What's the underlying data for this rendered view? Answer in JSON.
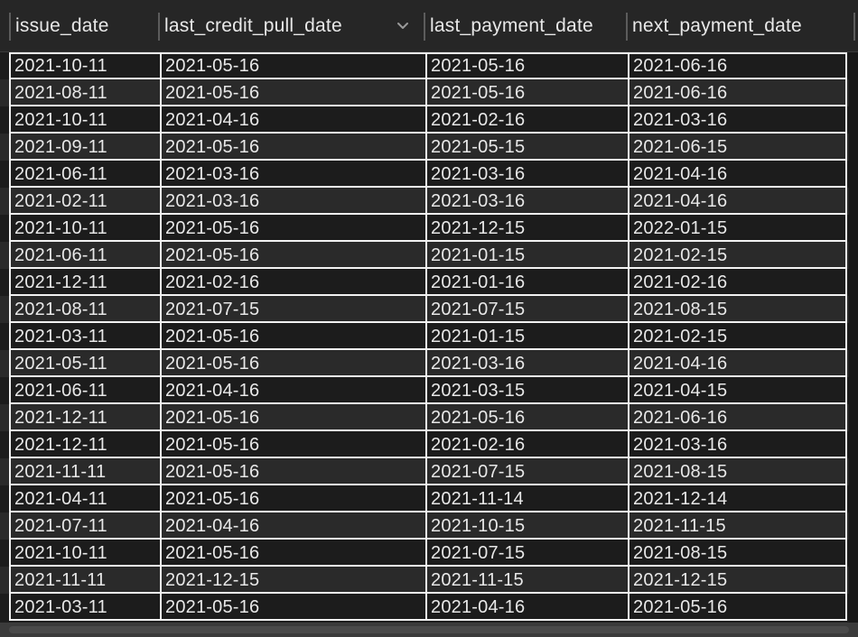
{
  "table": {
    "columns": [
      {
        "label": "issue_date"
      },
      {
        "label": "last_credit_pull_date",
        "sort_icon": "chevron-down-icon"
      },
      {
        "label": "last_payment_date"
      },
      {
        "label": "next_payment_date"
      }
    ],
    "rows": [
      [
        "2021-10-11",
        "2021-05-16",
        "2021-05-16",
        "2021-06-16"
      ],
      [
        "2021-08-11",
        "2021-05-16",
        "2021-05-16",
        "2021-06-16"
      ],
      [
        "2021-10-11",
        "2021-04-16",
        "2021-02-16",
        "2021-03-16"
      ],
      [
        "2021-09-11",
        "2021-05-16",
        "2021-05-15",
        "2021-06-15"
      ],
      [
        "2021-06-11",
        "2021-03-16",
        "2021-03-16",
        "2021-04-16"
      ],
      [
        "2021-02-11",
        "2021-03-16",
        "2021-03-16",
        "2021-04-16"
      ],
      [
        "2021-10-11",
        "2021-05-16",
        "2021-12-15",
        "2022-01-15"
      ],
      [
        "2021-06-11",
        "2021-05-16",
        "2021-01-15",
        "2021-02-15"
      ],
      [
        "2021-12-11",
        "2021-02-16",
        "2021-01-16",
        "2021-02-16"
      ],
      [
        "2021-08-11",
        "2021-07-15",
        "2021-07-15",
        "2021-08-15"
      ],
      [
        "2021-03-11",
        "2021-05-16",
        "2021-01-15",
        "2021-02-15"
      ],
      [
        "2021-05-11",
        "2021-05-16",
        "2021-03-16",
        "2021-04-16"
      ],
      [
        "2021-06-11",
        "2021-04-16",
        "2021-03-15",
        "2021-04-15"
      ],
      [
        "2021-12-11",
        "2021-05-16",
        "2021-05-16",
        "2021-06-16"
      ],
      [
        "2021-12-11",
        "2021-05-16",
        "2021-02-16",
        "2021-03-16"
      ],
      [
        "2021-11-11",
        "2021-05-16",
        "2021-07-15",
        "2021-08-15"
      ],
      [
        "2021-04-11",
        "2021-05-16",
        "2021-11-14",
        "2021-12-14"
      ],
      [
        "2021-07-11",
        "2021-04-16",
        "2021-10-15",
        "2021-11-15"
      ],
      [
        "2021-10-11",
        "2021-05-16",
        "2021-07-15",
        "2021-08-15"
      ],
      [
        "2021-11-11",
        "2021-12-15",
        "2021-11-15",
        "2021-12-15"
      ],
      [
        "2021-03-11",
        "2021-05-16",
        "2021-04-16",
        "2021-05-16"
      ]
    ]
  },
  "colors": {
    "background": "#1e1e1e",
    "header_background": "#262626",
    "row_odd": "#2a2a2a",
    "row_even": "#1c1c1c",
    "grid_line": "#f2f2f2",
    "text": "#e8e8e8"
  }
}
